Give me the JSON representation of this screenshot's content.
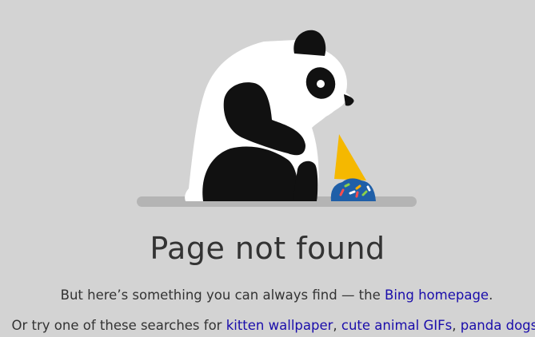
{
  "page": {
    "title": "Page not found"
  },
  "message": {
    "line1_prefix": "But here’s something you can always find — the ",
    "home_link": "Bing homepage",
    "line1_suffix": ".",
    "line2_prefix": "Or try one of these searches for ",
    "search_links": [
      "kitten wallpaper",
      "cute animal GIFs",
      "panda dogs"
    ],
    "separator": ", ",
    "line2_suffix": "."
  },
  "illustration": {
    "subject": "sad-panda-with-dropped-ice-cream",
    "colors": {
      "background": "#d3d3d3",
      "panda_white": "#ffffff",
      "panda_black": "#111111",
      "ground": "#b4b4b4",
      "cone": "#f5b800",
      "ice_cream": "#1f5fa8"
    }
  },
  "colors": {
    "link": "#1a0dab",
    "text": "#333333"
  }
}
